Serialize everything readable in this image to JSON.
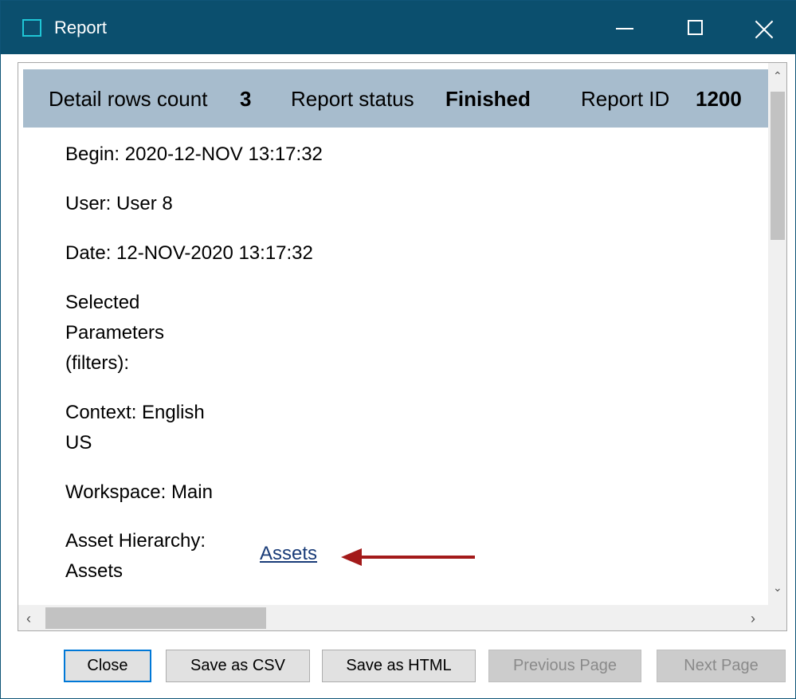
{
  "window": {
    "title": "Report",
    "icon": "window-icon",
    "controls": {
      "minimize": "minimize-icon",
      "maximize": "maximize-icon",
      "close": "close-icon"
    }
  },
  "status_bar": {
    "detail_rows_label": "Detail rows count",
    "detail_rows_value": "3",
    "report_status_label": "Report status",
    "report_status_value": "Finished",
    "report_id_label": "Report ID",
    "report_id_value": "1200"
  },
  "fields": {
    "begin": "Begin: 2020-12-NOV 13:17:32",
    "user": "User: User 8",
    "date": "Date: 12-NOV-2020 13:17:32",
    "selected_parameters": [
      "Selected",
      "Parameters",
      "(filters):"
    ],
    "context": [
      "Context: English",
      "US"
    ],
    "workspace": "Workspace: Main",
    "asset_hierarchy": [
      "Asset Hierarchy:",
      "Assets"
    ]
  },
  "asset_link": "Assets",
  "annotation": {
    "arrow_color": "#a31a1a"
  },
  "buttons": {
    "close": "Close",
    "save_csv": "Save as CSV",
    "save_html": "Save as HTML",
    "previous_page": "Previous Page",
    "next_page": "Next Page"
  },
  "colors": {
    "titlebar": "#0b4f6e",
    "status_bar": "#a7bccd",
    "link": "#1a3c78"
  }
}
